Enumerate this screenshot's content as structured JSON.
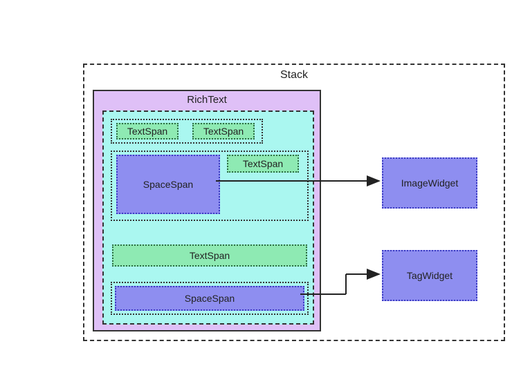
{
  "stack": {
    "title": "Stack"
  },
  "richtext": {
    "title": "RichText"
  },
  "spans": {
    "ts1": "TextSpan",
    "ts2": "TextSpan",
    "ts3": "TextSpan",
    "ss1": "SpaceSpan",
    "ts4": "TextSpan",
    "ss2": "SpaceSpan"
  },
  "widgets": {
    "image": "ImageWidget",
    "tag": "TagWidget"
  },
  "chart_data": {
    "type": "diagram",
    "title": "Stack / RichText span layout",
    "nodes": [
      {
        "id": "stack",
        "label": "Stack",
        "kind": "container"
      },
      {
        "id": "richtext",
        "label": "RichText",
        "parent": "stack",
        "kind": "container"
      },
      {
        "id": "cyan",
        "label": "",
        "parent": "richtext",
        "kind": "container"
      },
      {
        "id": "row1",
        "label": "",
        "parent": "cyan",
        "kind": "group"
      },
      {
        "id": "ts1",
        "label": "TextSpan",
        "parent": "row1",
        "kind": "TextSpan"
      },
      {
        "id": "ts2",
        "label": "TextSpan",
        "parent": "row1",
        "kind": "TextSpan"
      },
      {
        "id": "row2",
        "label": "",
        "parent": "cyan",
        "kind": "group"
      },
      {
        "id": "ss1",
        "label": "SpaceSpan",
        "parent": "row2",
        "kind": "SpaceSpan"
      },
      {
        "id": "ts3",
        "label": "TextSpan",
        "parent": "row2",
        "kind": "TextSpan"
      },
      {
        "id": "ts4",
        "label": "TextSpan",
        "parent": "cyan",
        "kind": "TextSpan"
      },
      {
        "id": "ss2",
        "label": "SpaceSpan",
        "parent": "cyan",
        "kind": "SpaceSpan"
      },
      {
        "id": "imgw",
        "label": "ImageWidget",
        "parent": "stack",
        "kind": "Widget"
      },
      {
        "id": "tagw",
        "label": "TagWidget",
        "parent": "stack",
        "kind": "Widget"
      }
    ],
    "edges": [
      {
        "from": "ss1",
        "to": "imgw"
      },
      {
        "from": "ss2",
        "to": "tagw"
      }
    ]
  }
}
